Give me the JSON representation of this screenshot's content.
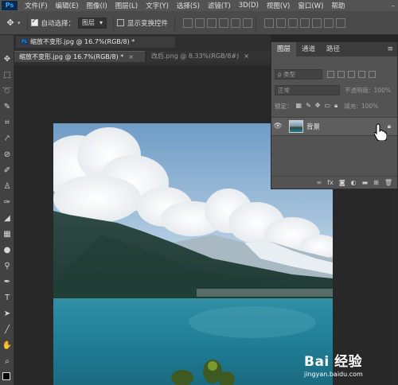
{
  "menubar": {
    "logo": "Ps",
    "items": [
      "文件(F)",
      "编辑(E)",
      "图像(I)",
      "图层(L)",
      "文字(Y)",
      "选择(S)",
      "滤镜(T)",
      "3D(D)",
      "视图(V)",
      "窗口(W)",
      "帮助"
    ]
  },
  "options": {
    "auto_select_label": "自动选择：",
    "auto_select_value": "图层",
    "show_transform_label": "显示变换控件"
  },
  "tabs": [
    {
      "title": "缩放不变形.jpg @ 16.7%(RGB/8) *",
      "active": true
    },
    {
      "title": "缩放不变形.jpg @ 16.7%(RGB/8) *",
      "active": true
    },
    {
      "title": "改后.png @ 8.33%(RGB/8#)",
      "active": false
    }
  ],
  "layers_panel": {
    "tabs": [
      "图层",
      "通道",
      "路径"
    ],
    "filter_label": "ρ 类型",
    "blend_mode": "正常",
    "opacity_label": "不透明度:",
    "opacity_value": "100%",
    "lock_label": "锁定：",
    "fill_label": "填充:",
    "fill_value": "100%",
    "layer_name": "背景",
    "footer_icons": [
      "link-icon",
      "fx-icon",
      "mask-icon",
      "adjustment-icon",
      "folder-icon",
      "new-layer-icon",
      "trash-icon"
    ]
  },
  "watermark": {
    "brand": "Bai 经验",
    "url": "jingyan.baidu.com"
  }
}
